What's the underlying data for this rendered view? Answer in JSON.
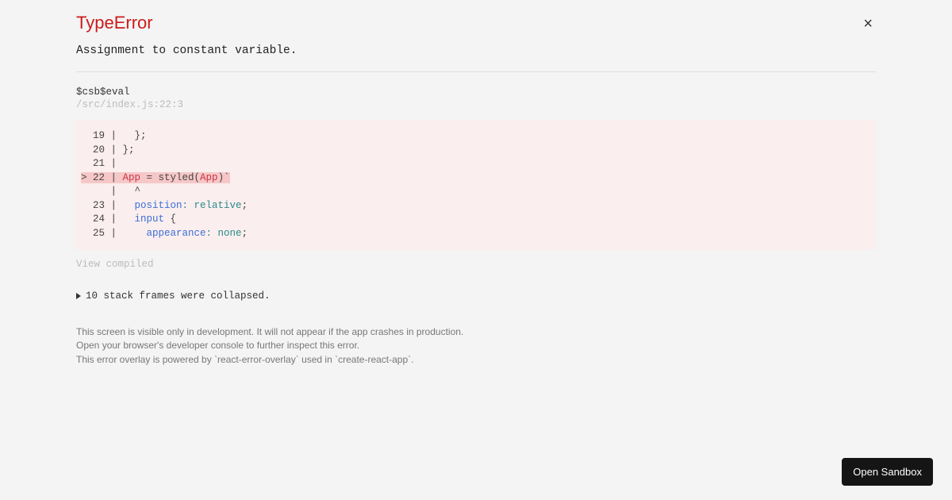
{
  "error": {
    "title": "TypeError",
    "message": "Assignment to constant variable."
  },
  "stack": {
    "fn": "$csb$eval",
    "location": "/src/index.js:22:3"
  },
  "code": {
    "l19": "  19 |   };",
    "l20": "  20 | };",
    "l21": "  21 | ",
    "l22_prefix": "> 22 | ",
    "l22_app": "App",
    "l22_eq": " = styled(",
    "l22_arg": "App",
    "l22_suffix": ")`",
    "l22_caret": "     |   ^",
    "l23_pre": "  23 |   ",
    "l23_prop": "position",
    "l23_colon": ": ",
    "l23_val": "relative",
    "l23_semi": ";",
    "l24_pre": "  24 |   ",
    "l24_sel": "input",
    "l24_brace": " {",
    "l25_pre": "  25 |     ",
    "l25_prop": "appearance",
    "l25_colon": ": ",
    "l25_val": "none",
    "l25_semi": ";"
  },
  "links": {
    "view_compiled": "View compiled",
    "collapsed": "10 stack frames were collapsed."
  },
  "footer": {
    "line1": "This screen is visible only in development. It will not appear if the app crashes in production.",
    "line2": "Open your browser's developer console to further inspect this error.",
    "line3": "This error overlay is powered by `react-error-overlay` used in `create-react-app`."
  },
  "sandbox_btn": "Open Sandbox"
}
